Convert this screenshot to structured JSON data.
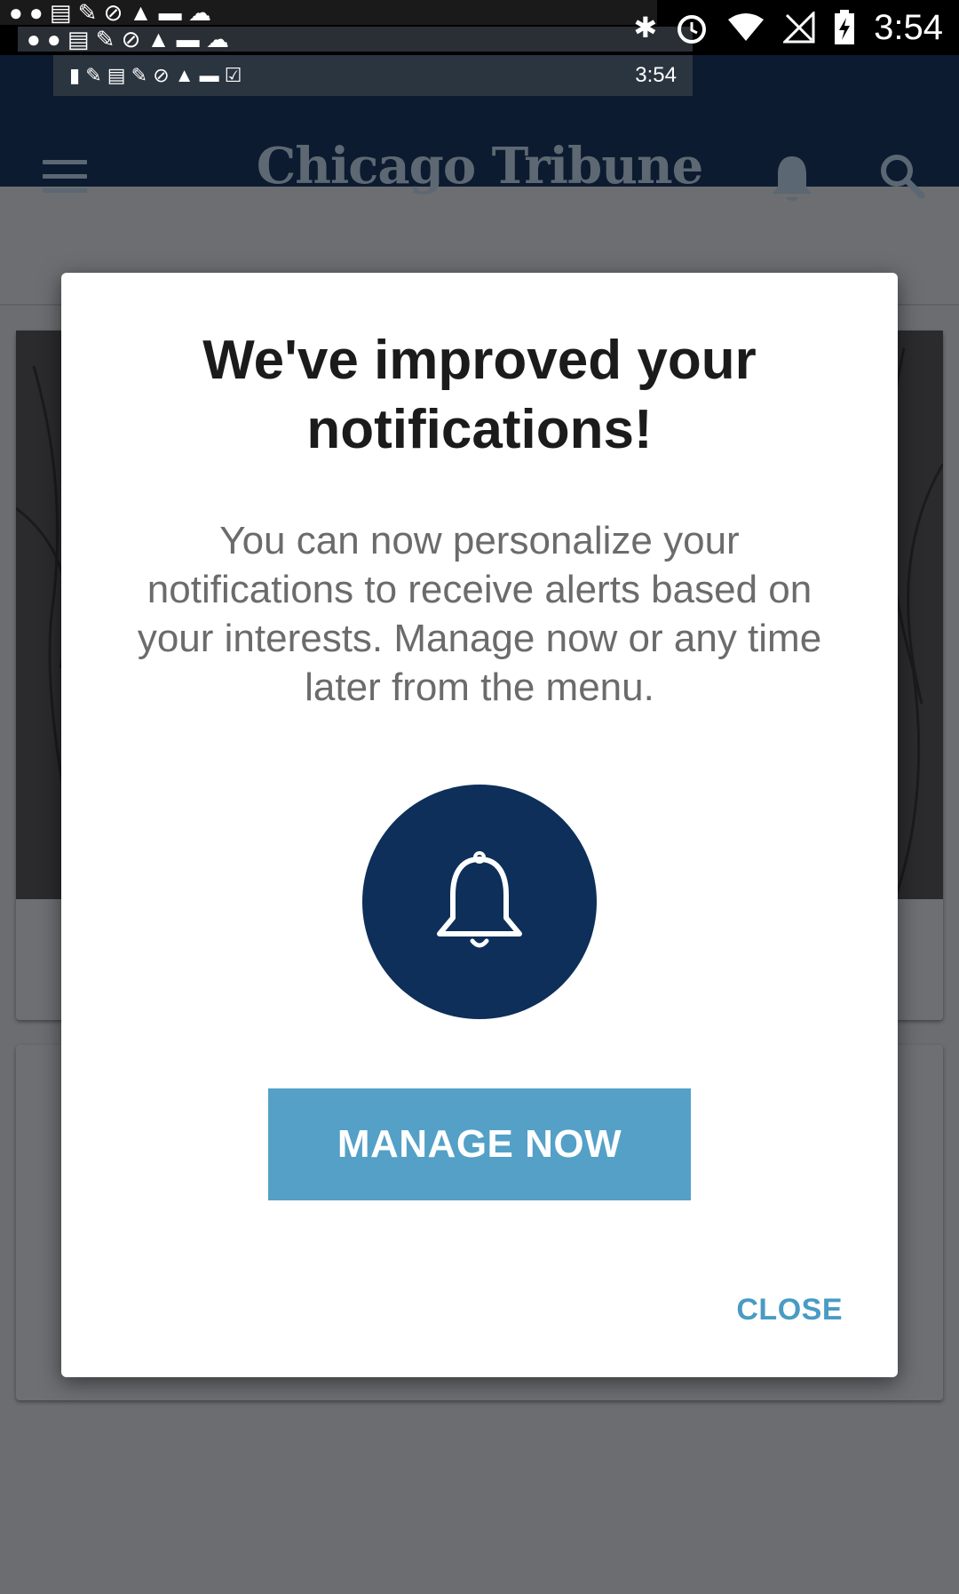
{
  "statusbar": {
    "time": "3:54",
    "ghost_time": "3:54",
    "icons": [
      "bluetooth-icon",
      "alarm-icon",
      "wifi-icon",
      "no-signal-icon",
      "battery-charging-icon"
    ]
  },
  "appbar": {
    "brand": "Chicago Tribune",
    "icons": [
      "menu-icon",
      "bell-icon",
      "search-icon"
    ]
  },
  "dialog": {
    "title": "We've improved your notifications!",
    "body": "You can now personalize your notifications to receive alerts based on your interests.  Manage now or any time later from the menu.",
    "icon": "bell-icon",
    "manage_label": "MANAGE NOW",
    "close_label": "CLOSE"
  },
  "colors": {
    "appbar": "#0c1b30",
    "bell_circle": "#0d2f5a",
    "manage_button": "#54a0c7",
    "close_text": "#4a9bc4",
    "scrim": "#6b6d70"
  }
}
